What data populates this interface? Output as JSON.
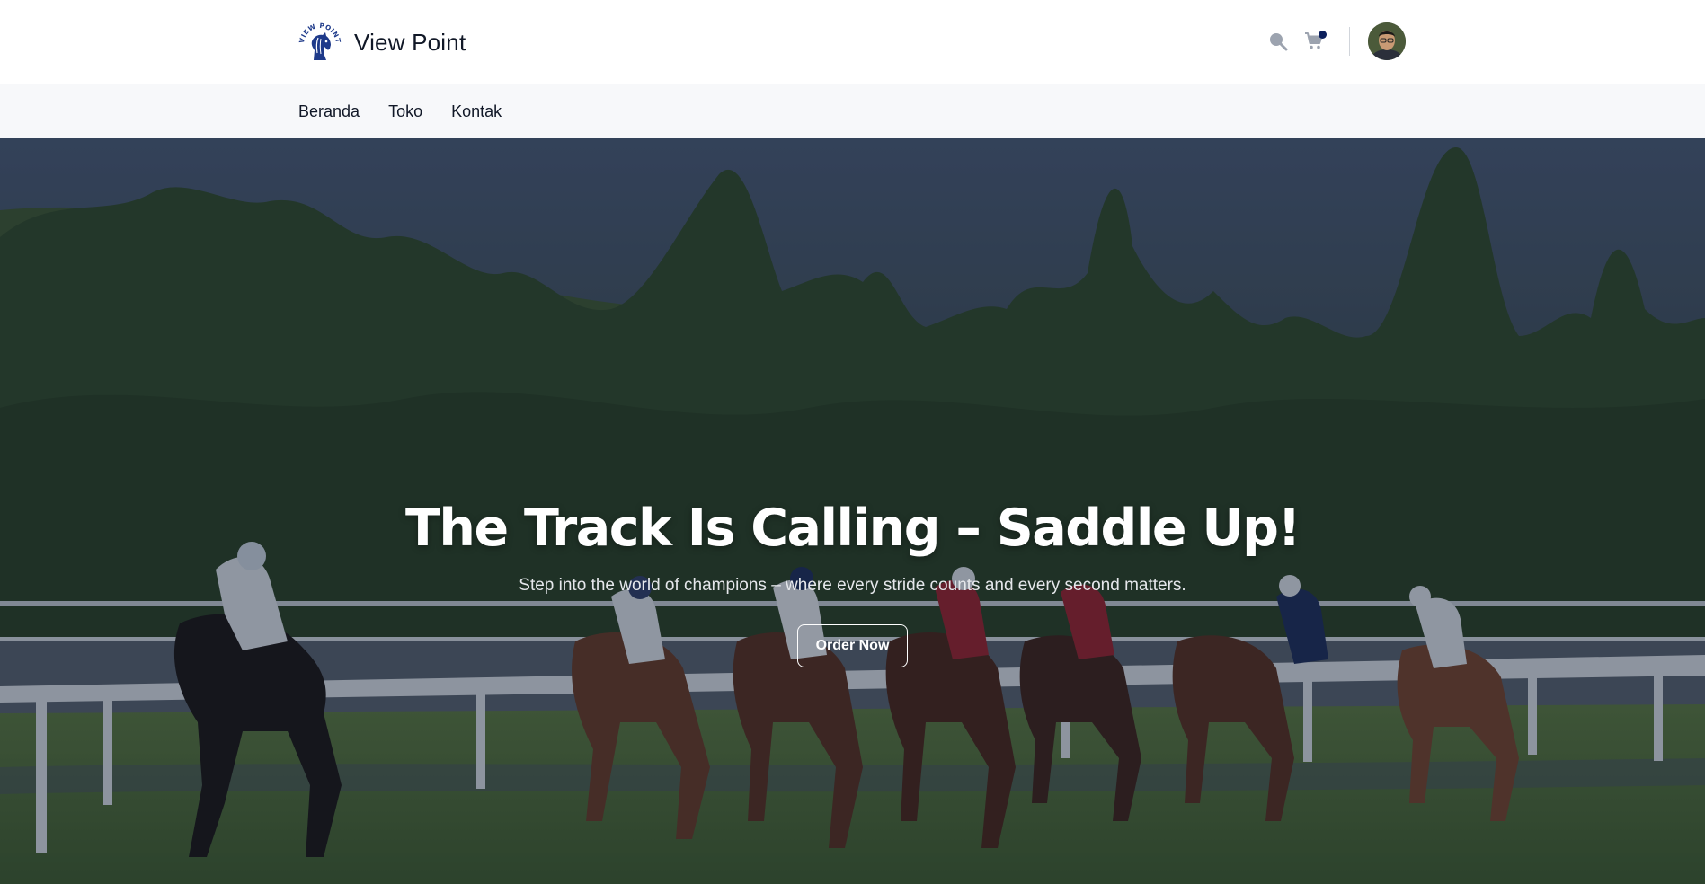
{
  "brand": {
    "name": "View Point",
    "logo_icon": "horse-head-logo-icon",
    "logo_ring_text": "VIEW POINT",
    "logo_color": "#1e3a8a"
  },
  "header": {
    "search_icon": "search-icon",
    "cart_icon": "cart-icon",
    "cart_badge_color": "#0b1f5c",
    "avatar_icon": "user-avatar"
  },
  "nav": {
    "items": [
      {
        "label": "Beranda"
      },
      {
        "label": "Toko"
      },
      {
        "label": "Kontak"
      }
    ]
  },
  "hero": {
    "title": "The Track Is Calling – Saddle Up!",
    "subtitle": "Step into the world of champions – where every stride counts and every second matters.",
    "cta_label": "Order Now",
    "background": "horse-racing-track-photo"
  }
}
